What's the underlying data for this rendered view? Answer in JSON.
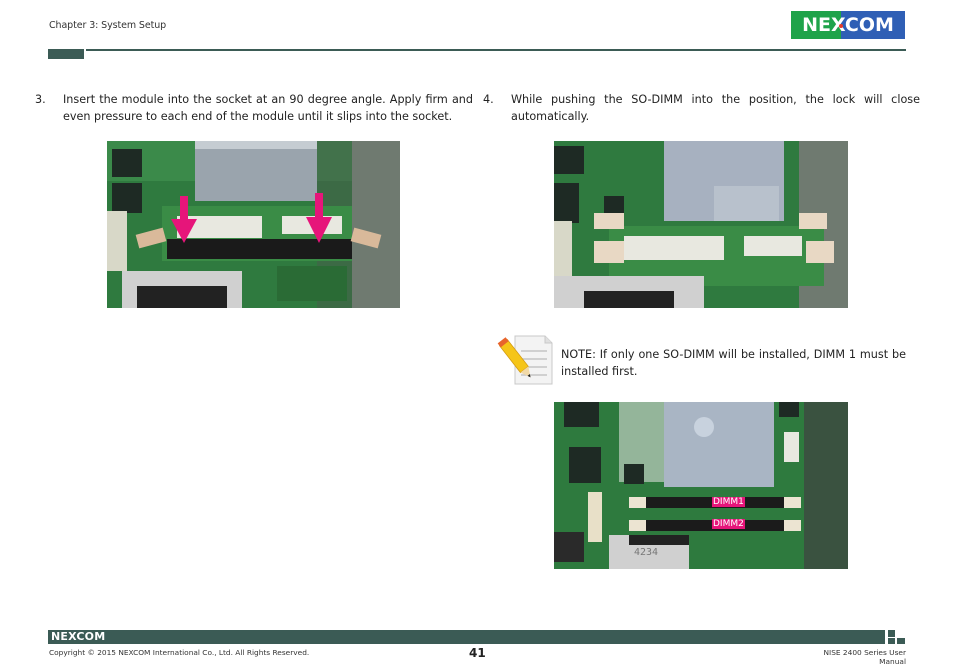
{
  "header": {
    "chapter": "Chapter 3: System Setup",
    "logo": {
      "text": "NEXCOM",
      "colors": {
        "left": "#1fa34a",
        "right": "#2f5fb5",
        "dot": "#e53b2b"
      }
    },
    "rule_color": "#3b5b55"
  },
  "steps": [
    {
      "number": "3.",
      "text": "Insert the module into the socket at an 90 degree angle. Apply firm and even pressure to each end of the module until it slips into the socket.",
      "image": {
        "description": "SO-DIMM module being pressed into socket with two magenta down arrows",
        "arrow_color": "#e6157a"
      }
    },
    {
      "number": "4.",
      "text": "While pushing the SO-DIMM into the position, the lock will close automatically.",
      "image": {
        "description": "SO-DIMM module locked in socket"
      }
    }
  ],
  "note": {
    "icon": "note-pencil-icon",
    "text": "NOTE: If only one SO-DIMM will be installed, DIMM 1 must be installed first.",
    "image": {
      "description": "Motherboard showing two SO-DIMM slots",
      "labels": [
        "DIMM1",
        "DIMM2"
      ],
      "label_color": "#e6157a",
      "silkscreen": "4234"
    }
  },
  "footer": {
    "logo": "NEXCOM",
    "copyright": "Copyright © 2015 NEXCOM International Co., Ltd. All Rights Reserved.",
    "page_number": "41",
    "manual_title": "NISE 2400 Series User Manual",
    "bar_color": "#3b5b55"
  }
}
